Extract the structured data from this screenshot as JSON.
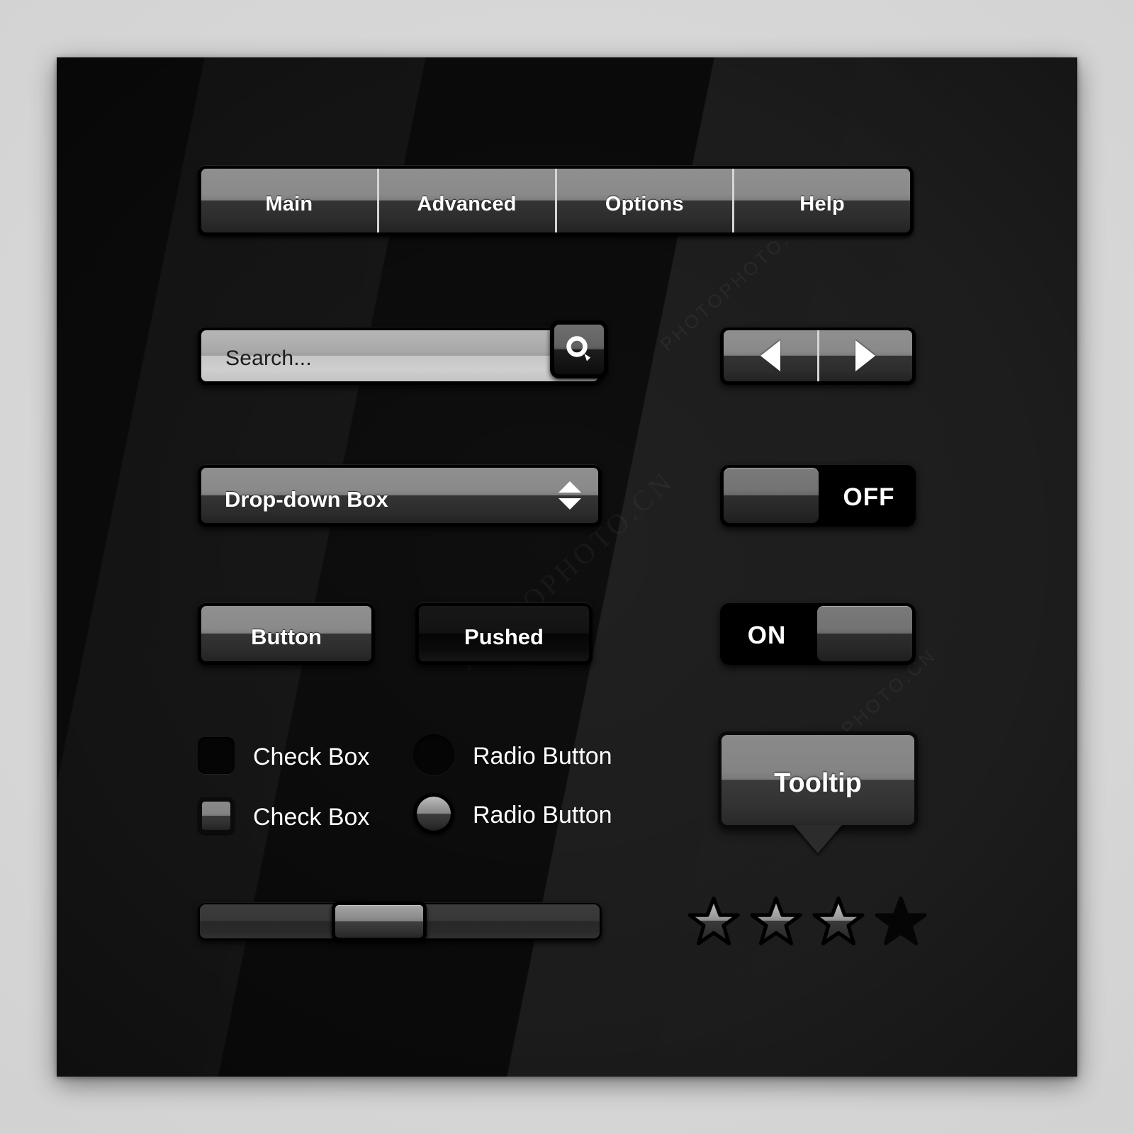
{
  "panel": {
    "background_color": "#0a0a0a",
    "outer_background_color": "#d7d7d7"
  },
  "tabs": {
    "items": [
      {
        "label": "Main"
      },
      {
        "label": "Advanced"
      },
      {
        "label": "Options"
      },
      {
        "label": "Help"
      }
    ]
  },
  "search": {
    "placeholder": "Search...",
    "value": "Search...",
    "icon": "search-icon"
  },
  "nav": {
    "prev_icon": "triangle-left-icon",
    "next_icon": "triangle-right-icon"
  },
  "dropdown": {
    "label": "Drop-down Box",
    "up_icon": "triangle-up-icon",
    "down_icon": "triangle-down-icon"
  },
  "toggles": [
    {
      "label": "OFF",
      "state": "off",
      "knob_side": "left"
    },
    {
      "label": "ON",
      "state": "on",
      "knob_side": "right"
    }
  ],
  "buttons": [
    {
      "label": "Button",
      "state": "normal"
    },
    {
      "label": "Pushed",
      "state": "pushed"
    }
  ],
  "checkboxes": [
    {
      "label": "Check Box",
      "checked": false
    },
    {
      "label": "Check Box",
      "checked": true
    }
  ],
  "radios": [
    {
      "label": "Radio Button",
      "selected": false
    },
    {
      "label": "Radio Button",
      "selected": true
    }
  ],
  "tooltip": {
    "label": "Tooltip"
  },
  "slider": {
    "value_percent": 33
  },
  "rating": {
    "total": 4,
    "filled": 3
  },
  "watermarks": {
    "line1": "PHOTOPHOTO.CN",
    "line2": "PHOTOPHOTO.CN",
    "line3": "PHOTO.CN"
  }
}
